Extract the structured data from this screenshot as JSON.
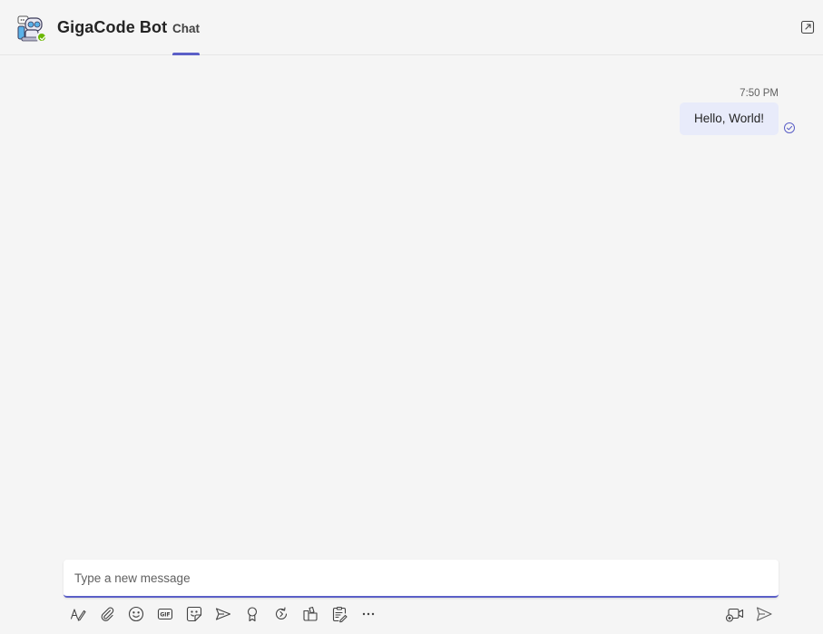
{
  "header": {
    "bot_name": "GigaCode Bot",
    "tab_chat_label": "Chat",
    "avatar_icon": "robot-avatar-icon",
    "presence_status": "available",
    "presence_color": "#6bb700",
    "popout_icon": "pop-out-icon"
  },
  "conversation": {
    "messages": [
      {
        "time": "7:50 PM",
        "text": "Hello, World!",
        "status_icon": "read-receipt-icon"
      }
    ]
  },
  "compose": {
    "placeholder": "Type a new message",
    "value": ""
  },
  "toolbar": {
    "items": [
      "format-icon",
      "attach-icon",
      "emoji-icon",
      "gif-icon",
      "sticker-icon",
      "schedule-meeting-icon",
      "praise-icon",
      "loop-icon",
      "apps-icon",
      "forms-icon",
      "more-options-icon"
    ],
    "right_items": [
      "video-clip-icon",
      "send-icon"
    ]
  },
  "colors": {
    "accent": "#5b5fc7",
    "bubble_background": "#e8ebfa",
    "background": "#f5f5f5"
  }
}
